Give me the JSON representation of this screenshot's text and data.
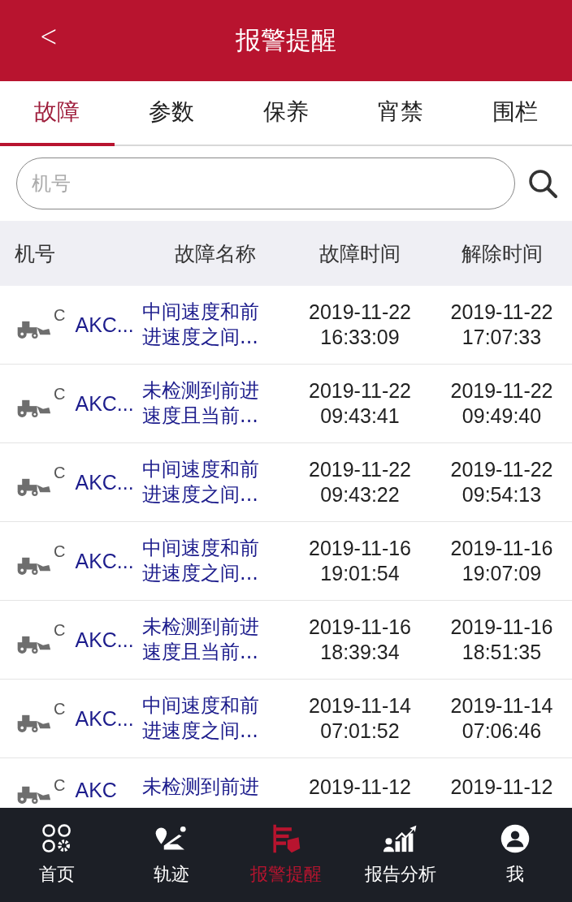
{
  "header": {
    "back": "<",
    "title": "报警提醒"
  },
  "tabs": [
    {
      "label": "故障",
      "selected": true
    },
    {
      "label": "参数",
      "selected": false
    },
    {
      "label": "保养",
      "selected": false
    },
    {
      "label": "宵禁",
      "selected": false
    },
    {
      "label": "围栏",
      "selected": false
    }
  ],
  "search": {
    "placeholder": "机号"
  },
  "table": {
    "columns": [
      "机号",
      "故障名称",
      "故障时间",
      "解除时间"
    ],
    "rows": [
      {
        "badge": "C",
        "machine": "AKC...",
        "fault": [
          "中间速度和前",
          "进速度之间..."
        ],
        "fault_time": [
          "2019-11-22",
          "16:33:09"
        ],
        "clear_time": [
          "2019-11-22",
          "17:07:33"
        ]
      },
      {
        "badge": "C",
        "machine": "AKC...",
        "fault": [
          "未检测到前进",
          "速度且当前..."
        ],
        "fault_time": [
          "2019-11-22",
          "09:43:41"
        ],
        "clear_time": [
          "2019-11-22",
          "09:49:40"
        ]
      },
      {
        "badge": "C",
        "machine": "AKC...",
        "fault": [
          "中间速度和前",
          "进速度之间..."
        ],
        "fault_time": [
          "2019-11-22",
          "09:43:22"
        ],
        "clear_time": [
          "2019-11-22",
          "09:54:13"
        ]
      },
      {
        "badge": "C",
        "machine": "AKC...",
        "fault": [
          "中间速度和前",
          "进速度之间..."
        ],
        "fault_time": [
          "2019-11-16",
          "19:01:54"
        ],
        "clear_time": [
          "2019-11-16",
          "19:07:09"
        ]
      },
      {
        "badge": "C",
        "machine": "AKC...",
        "fault": [
          "未检测到前进",
          "速度且当前..."
        ],
        "fault_time": [
          "2019-11-16",
          "18:39:34"
        ],
        "clear_time": [
          "2019-11-16",
          "18:51:35"
        ]
      },
      {
        "badge": "C",
        "machine": "AKC...",
        "fault": [
          "中间速度和前",
          "进速度之间..."
        ],
        "fault_time": [
          "2019-11-14",
          "07:01:52"
        ],
        "clear_time": [
          "2019-11-14",
          "07:06:46"
        ]
      },
      {
        "badge": "C",
        "machine": "AKC",
        "fault": [
          "未检测到前进"
        ],
        "fault_time": [
          "2019-11-12"
        ],
        "clear_time": [
          "2019-11-12"
        ]
      }
    ]
  },
  "nav": [
    {
      "kind": "home",
      "label": "首页",
      "selected": false
    },
    {
      "kind": "track",
      "label": "轨迹",
      "selected": false
    },
    {
      "kind": "alarm",
      "label": "报警提醒",
      "selected": true
    },
    {
      "kind": "report",
      "label": "报告分析",
      "selected": false
    },
    {
      "kind": "me",
      "label": "我",
      "selected": false
    }
  ]
}
